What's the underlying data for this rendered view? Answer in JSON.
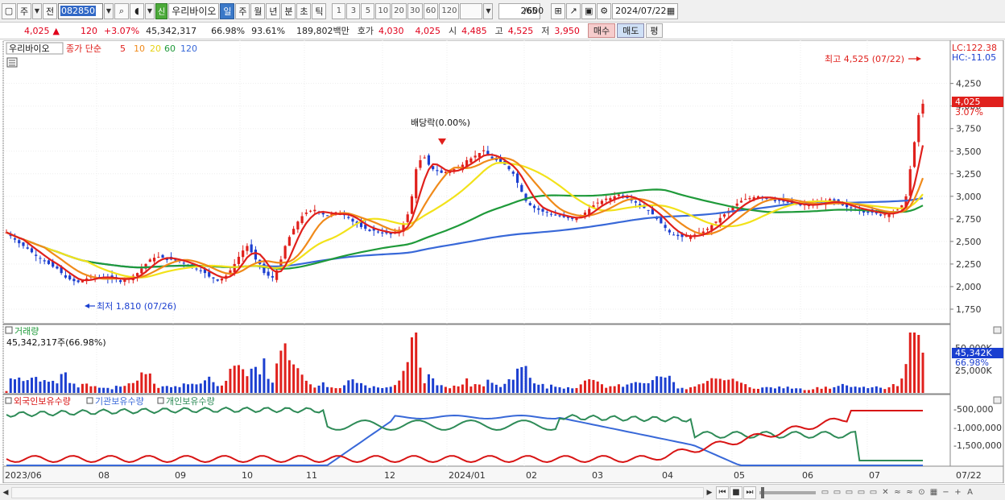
{
  "toolbar": {
    "market": "주",
    "prev": "전",
    "code": "082850",
    "new_badge": "신",
    "stock_name": "우리바이오",
    "periods": [
      "일",
      "주",
      "월",
      "년",
      "분",
      "초",
      "틱"
    ],
    "active_period": "일",
    "intervals": [
      "1",
      "3",
      "5",
      "10",
      "20",
      "30",
      "60",
      "120"
    ],
    "count": "265",
    "count_total": "/600",
    "date": "2024/07/22"
  },
  "pricebar": {
    "price": "4,025",
    "change_arrow": "▲",
    "change": "120",
    "change_pct": "+3.07%",
    "volume": "45,342,317",
    "volume_ratio": "66.98%",
    "turnover_ratio": "93.61%",
    "amount": "189,802백만",
    "quote_label": "호가",
    "ask": "4,030",
    "bid": "4,025",
    "open_label": "시",
    "open": "4,485",
    "high_label": "고",
    "high": "4,525",
    "low_label": "저",
    "low": "3,950",
    "buy": "매수",
    "sell": "매도",
    "eval": "평"
  },
  "chart": {
    "legend_name": "우리바이오",
    "legend_ma_label": "종가 단순",
    "ma_periods": [
      "5",
      "10",
      "20",
      "60",
      "120"
    ],
    "lc_label": "LC:122.38",
    "hc_label": "HC:-11.05",
    "high_annotation": "최고 4,525 (07/22)",
    "low_annotation": "최저 1,810 (07/26)",
    "dividend_annotation": "배당락(0.00%)",
    "current_price_tag": "4,025",
    "current_pct_tag": "3.07%",
    "volume_label": "거래량",
    "volume_value": "45,342,317주(66.98%)",
    "volume_tag": "45,342K",
    "volume_pct_tag": "66.98%",
    "holdings_labels": [
      "외국인보유수량",
      "기관보유수량",
      "개인보유수량"
    ]
  },
  "colors": {
    "ma5": "#e0201c",
    "ma10": "#f08a1a",
    "ma20": "#f2e21a",
    "ma60": "#1f9a3a",
    "ma120": "#3868d8",
    "up": "#e0201c",
    "down": "#1c3fd0",
    "foreign": "#d81414",
    "institution": "#3868d8",
    "individual": "#2e8b57"
  },
  "chart_data": {
    "type": "line",
    "price_axis": {
      "ticks": [
        "4,250",
        "4,000",
        "3,750",
        "3,500",
        "3,250",
        "3,000",
        "2,750",
        "2,500",
        "2,250",
        "2,000",
        "1,750"
      ],
      "ylim": [
        1625,
        4675
      ]
    },
    "volume_axis": {
      "ticks": [
        "50,000K",
        "25,000K"
      ]
    },
    "holdings_axis": {
      "ticks": [
        "-500,000",
        "-1,000,000",
        "-1,500,000"
      ]
    },
    "x_labels": [
      "2023/06",
      "08",
      "09",
      "10",
      "11",
      "12",
      "2024/01",
      "02",
      "03",
      "04",
      "05",
      "06",
      "07",
      "07/22"
    ],
    "close": [
      2600,
      2560,
      2520,
      2480,
      2450,
      2420,
      2380,
      2340,
      2310,
      2280,
      2250,
      2220,
      2200,
      2150,
      2100,
      2080,
      2060,
      2050,
      2070,
      2090,
      2100,
      2110,
      2105,
      2100,
      2095,
      2090,
      2080,
      2070,
      2080,
      2100,
      2120,
      2150,
      2200,
      2250,
      2300,
      2320,
      2330,
      2320,
      2310,
      2300,
      2290,
      2280,
      2260,
      2240,
      2220,
      2200,
      2180,
      2150,
      2110,
      2090,
      2080,
      2090,
      2120,
      2180,
      2250,
      2330,
      2400,
      2450,
      2380,
      2300,
      2250,
      2150,
      2120,
      2100,
      2180,
      2300,
      2450,
      2550,
      2640,
      2720,
      2780,
      2820,
      2840,
      2850,
      2830,
      2800,
      2790,
      2800,
      2810,
      2820,
      2800,
      2760,
      2720,
      2690,
      2660,
      2640,
      2630,
      2620,
      2610,
      2600,
      2590,
      2580,
      2600,
      2630,
      2700,
      2800,
      3000,
      3300,
      3400,
      3430,
      3350,
      3300,
      3280,
      3260,
      3270,
      3280,
      3300,
      3320,
      3350,
      3400,
      3420,
      3450,
      3480,
      3500,
      3450,
      3420,
      3400,
      3380,
      3350,
      3300,
      3250,
      3150,
      3050,
      2950,
      2900,
      2870,
      2850,
      2830,
      2820,
      2800,
      2790,
      2780,
      2770,
      2760,
      2750,
      2760,
      2780,
      2820,
      2860,
      2900,
      2930,
      2950,
      2960,
      2980,
      3000,
      3020,
      3010,
      2990,
      2960,
      2930,
      2900,
      2870,
      2840,
      2800,
      2750,
      2700,
      2650,
      2600,
      2570,
      2560,
      2550,
      2550,
      2560,
      2570,
      2590,
      2610,
      2640,
      2680,
      2720,
      2760,
      2800,
      2840,
      2880,
      2920,
      2950,
      2970,
      2980,
      2990,
      3000,
      2990,
      2980,
      2970,
      2960,
      2950,
      2940,
      2930,
      2920,
      2910,
      2900,
      2900,
      2905,
      2910,
      2920,
      2930,
      2940,
      2950,
      2940,
      2920,
      2900,
      2880,
      2870,
      2860,
      2850,
      2840,
      2830,
      2820,
      2810,
      2800,
      2800,
      2810,
      2830,
      2850,
      2900,
      3000,
      3300,
      3600,
      3900,
      4025
    ]
  }
}
